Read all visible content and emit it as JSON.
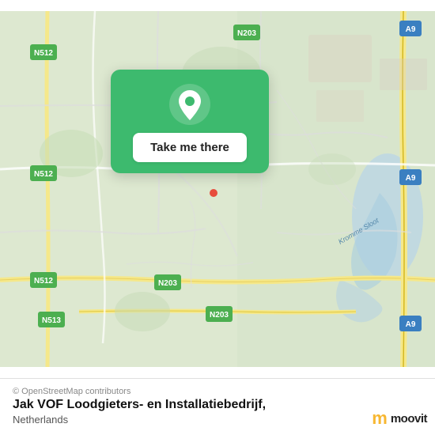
{
  "map": {
    "alt": "Map of Jak VOF Loodgieters- en Installatiebedrijf location"
  },
  "card": {
    "button_label": "Take me there"
  },
  "bottom_bar": {
    "attribution": "© OpenStreetMap contributors",
    "title": "Jak VOF Loodgieters- en Installatiebedrijf,",
    "subtitle": "Netherlands"
  },
  "moovit": {
    "label": "moovit"
  }
}
